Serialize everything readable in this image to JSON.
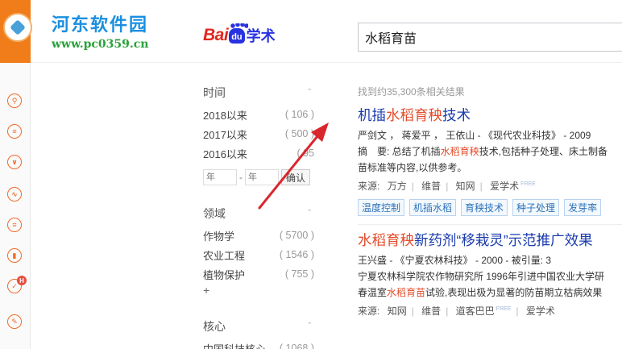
{
  "watermark": {
    "title": "河东软件园",
    "url": "www.pc0359.cn"
  },
  "header": {
    "logo": {
      "bai": "Bai",
      "du": "du",
      "xueshu": "学术"
    },
    "search_value": "水稻育苗"
  },
  "rail": {
    "badge": "H"
  },
  "filters": {
    "time": {
      "title": "时间",
      "rows": [
        {
          "label": "2018以来",
          "count": "( 106 )"
        },
        {
          "label": "2017以来",
          "count": "( 500 )"
        },
        {
          "label": "2016以来",
          "count": "( 95"
        }
      ],
      "from_placeholder": "年",
      "to_placeholder": "年",
      "range_dash": "-",
      "confirm": "确认"
    },
    "field": {
      "title": "领域",
      "rows": [
        {
          "label": "作物学",
          "count": "( 5700 )"
        },
        {
          "label": "农业工程",
          "count": "( 1546 )"
        },
        {
          "label": "植物保护",
          "count": "( 755 )"
        }
      ],
      "more": "+"
    },
    "core": {
      "title": "核心",
      "rows": [
        {
          "label": "中国科技核心",
          "count": "( 1068 )"
        }
      ]
    }
  },
  "results": {
    "count_text": "找到约35,300条相关结果",
    "items": [
      {
        "title_a": "机插",
        "title_hl": "水稻育秧",
        "title_b": "技术",
        "meta": "严剑文 ， 蒋爱平 ， 王依山 - 《现代农业科技》 - 2009",
        "abs1_a": "摘　要: 总结了机插",
        "abs1_hl": "水稻育秧",
        "abs1_b": "技术,包括种子处理、床土制备",
        "abs2": "苗标准等内容,以供参考。",
        "src_label": "来源:",
        "sources": [
          "万方",
          "维普",
          "知网",
          "爱学术"
        ],
        "free": "FREE",
        "tags": [
          "温度控制",
          "机插水稻",
          "育秧技术",
          "种子处理",
          "发芽率"
        ]
      },
      {
        "title_hl1": "水稻育秧",
        "title_b": "新药剂“移栽灵”示范推广效果",
        "meta": "王兴盛 - 《宁夏农林科技》 - 2000 - 被引量: 3",
        "abs1": "宁夏农林科学院农作物研究所 1996年引进中国农业大学研",
        "abs2_a": "春温室",
        "abs2_hl": "水稻育苗",
        "abs2_b": "试验,表现出极为显著的防苗期立枯病效果",
        "src_label": "来源:",
        "sources": [
          "知网",
          "维普",
          "道客巴巴",
          "爱学术"
        ],
        "free": "FREE"
      }
    ]
  },
  "colors": {
    "accent": "#f07d1a",
    "link": "#1a3cad",
    "highlight": "#e34c2a",
    "arrow": "#d9262c"
  }
}
